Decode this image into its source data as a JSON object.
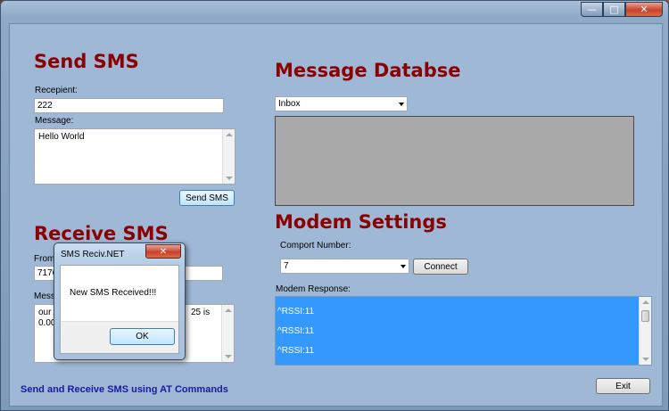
{
  "window": {
    "controls": {
      "minimize": "—",
      "maximize": "□",
      "close": "✕"
    }
  },
  "send_sms": {
    "heading": "Send SMS",
    "recipient_label": "Recepient:",
    "recipient_value": "222",
    "message_label": "Message:",
    "message_value": "Hello World",
    "send_button": "Send SMS"
  },
  "receive_sms": {
    "heading": "Receive SMS",
    "from_label": "From:",
    "from_value": "7176",
    "message_label": "Messa",
    "message_left": "our Ac",
    "message_right": "25 is",
    "message_line2": "0.00 Y"
  },
  "database": {
    "heading": "Message Databse",
    "folder_selected": "Inbox"
  },
  "modem": {
    "heading": "Modem Settings",
    "comport_label": "Comport Number:",
    "comport_selected": "7",
    "connect_button": "Connect",
    "response_label": "Modem Response:",
    "response_lines": [
      "^RSSI:11",
      "^RSSI:11",
      "^RSSI:11"
    ]
  },
  "footer": {
    "caption": "Send and Receive SMS using AT Commands",
    "exit_button": "Exit"
  },
  "dialog": {
    "title": "SMS Reciv.NET",
    "close": "✕",
    "message": "New SMS Received!!!",
    "ok_button": "OK"
  }
}
